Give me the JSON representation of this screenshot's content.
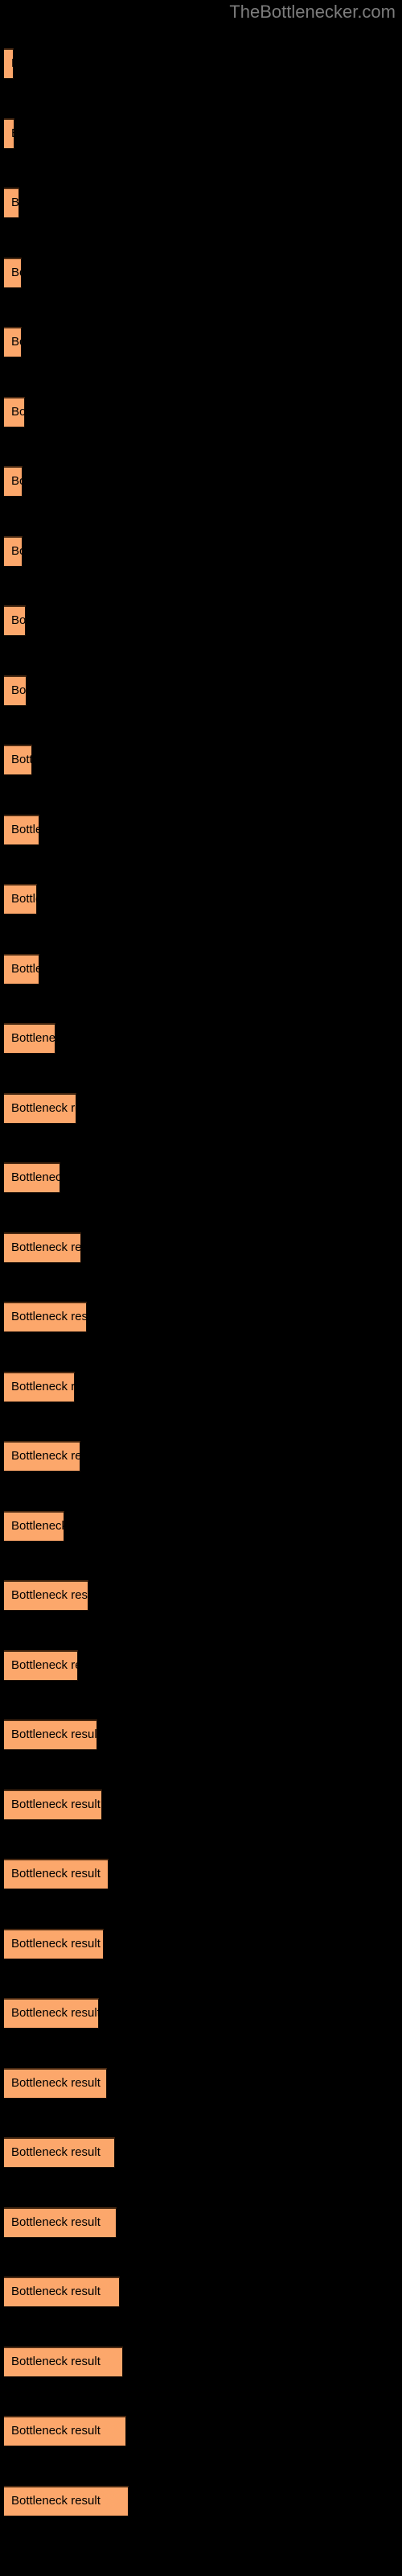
{
  "watermark": {
    "text": "TheBottlenecker.com",
    "color": "#7c7c7c"
  },
  "style": {
    "background": "#000000",
    "bar_fill": "#FCA76B",
    "bar_top_border": "#4a2a12",
    "label_color": "#000000"
  },
  "chart_data": {
    "type": "bar",
    "orientation": "horizontal",
    "title": "TheBottlenecker.com",
    "xlabel": "",
    "ylabel": "",
    "grid": false,
    "legend": false,
    "xlim": [
      0,
      160
    ],
    "categories": [
      "Bottleneck result",
      "Bottleneck result",
      "Bottleneck result",
      "Bottleneck result",
      "Bottleneck result",
      "Bottleneck result",
      "Bottleneck result",
      "Bottleneck result",
      "Bottleneck result",
      "Bottleneck result",
      "Bottleneck result",
      "Bottleneck result",
      "Bottleneck result",
      "Bottleneck result",
      "Bottleneck result",
      "Bottleneck result",
      "Bottleneck result",
      "Bottleneck result",
      "Bottleneck result",
      "Bottleneck result",
      "Bottleneck result",
      "Bottleneck result",
      "Bottleneck result",
      "Bottleneck result",
      "Bottleneck result",
      "Bottleneck result",
      "Bottleneck result",
      "Bottleneck result",
      "Bottleneck result",
      "Bottleneck result",
      "Bottleneck result",
      "Bottleneck result",
      "Bottleneck result",
      "Bottleneck result",
      "Bottleneck result",
      "Bottleneck result"
    ],
    "values": [
      12,
      13,
      19,
      22,
      22,
      26,
      23,
      23,
      27,
      28,
      35,
      44,
      41,
      44,
      64,
      90,
      70,
      96,
      103,
      88,
      95,
      75,
      105,
      92,
      116,
      122,
      130,
      124,
      118,
      128,
      138,
      140,
      144,
      148,
      152,
      155
    ],
    "bars": [
      {
        "label": "Bottleneck result",
        "width": 12,
        "y": 60
      },
      {
        "label": "Bottleneck result",
        "width": 13,
        "y": 147
      },
      {
        "label": "Bottleneck result",
        "width": 19,
        "y": 233
      },
      {
        "label": "Bottleneck result",
        "width": 22,
        "y": 320
      },
      {
        "label": "Bottleneck result",
        "width": 22,
        "y": 406
      },
      {
        "label": "Bottleneck result",
        "width": 26,
        "y": 493
      },
      {
        "label": "Bottleneck result",
        "width": 23,
        "y": 579
      },
      {
        "label": "Bottleneck result",
        "width": 23,
        "y": 666
      },
      {
        "label": "Bottleneck result",
        "width": 27,
        "y": 752
      },
      {
        "label": "Bottleneck result",
        "width": 28,
        "y": 839
      },
      {
        "label": "Bottleneck result",
        "width": 35,
        "y": 925
      },
      {
        "label": "Bottleneck result",
        "width": 44,
        "y": 1012
      },
      {
        "label": "Bottleneck result",
        "width": 41,
        "y": 1098
      },
      {
        "label": "Bottleneck result",
        "width": 44,
        "y": 1185
      },
      {
        "label": "Bottleneck result",
        "width": 64,
        "y": 1271
      },
      {
        "label": "Bottleneck result",
        "width": 90,
        "y": 1358
      },
      {
        "label": "Bottleneck result",
        "width": 70,
        "y": 1444
      },
      {
        "label": "Bottleneck result",
        "width": 96,
        "y": 1531
      },
      {
        "label": "Bottleneck result",
        "width": 103,
        "y": 1617
      },
      {
        "label": "Bottleneck result",
        "width": 88,
        "y": 1704
      },
      {
        "label": "Bottleneck result",
        "width": 95,
        "y": 1790
      },
      {
        "label": "Bottleneck result",
        "width": 75,
        "y": 1877
      },
      {
        "label": "Bottleneck result",
        "width": 105,
        "y": 1963
      },
      {
        "label": "Bottleneck result",
        "width": 92,
        "y": 2050
      },
      {
        "label": "Bottleneck result",
        "width": 116,
        "y": 2136
      },
      {
        "label": "Bottleneck result",
        "width": 122,
        "y": 2223
      },
      {
        "label": "Bottleneck result",
        "width": 130,
        "y": 2309
      },
      {
        "label": "Bottleneck result",
        "width": 124,
        "y": 2396
      },
      {
        "label": "Bottleneck result",
        "width": 118,
        "y": 2482
      },
      {
        "label": "Bottleneck result",
        "width": 128,
        "y": 2569
      },
      {
        "label": "Bottleneck result",
        "width": 138,
        "y": 2655
      },
      {
        "label": "Bottleneck result",
        "width": 140,
        "y": 2742
      },
      {
        "label": "Bottleneck result",
        "width": 144,
        "y": 2828
      },
      {
        "label": "Bottleneck result",
        "width": 148,
        "y": 2915
      },
      {
        "label": "Bottleneck result",
        "width": 152,
        "y": 3001
      },
      {
        "label": "Bottleneck result",
        "width": 155,
        "y": 3088
      }
    ]
  }
}
